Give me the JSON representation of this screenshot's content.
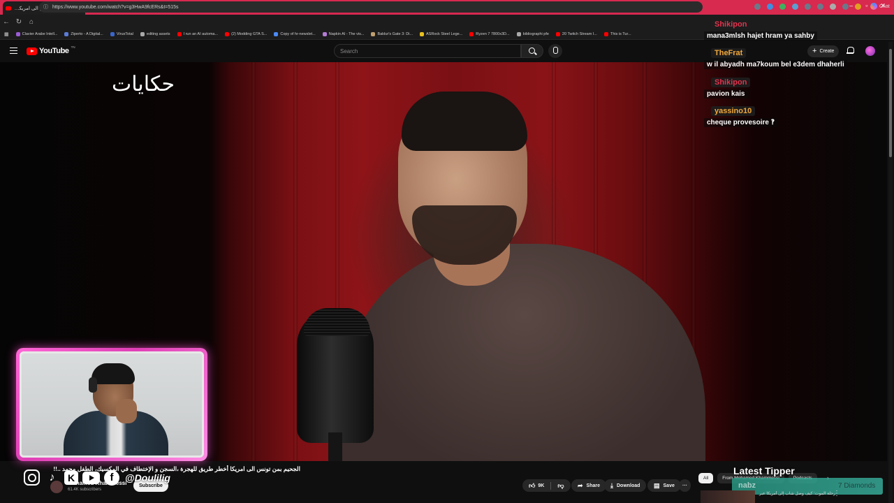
{
  "browser": {
    "tab_title": "الجحيم بمن تونس الى امريكا أخطر...",
    "url": "https://www.youtube.com/watch?v=g3HwA9fcERs&t=515s",
    "window_controls": [
      "–",
      "▫",
      "✕"
    ],
    "new_tab_label": "+",
    "chat_ext_label": "Chat",
    "bookmarks": [
      "Clavier Arabe Intell...",
      "Ziperto - A Digital...",
      "VirusTotal",
      "editing assets",
      "I run an AI automa...",
      "(2) Modding GTA S...",
      "Copy of hr-newslet...",
      "Napkin AI - The vis...",
      "Baldur's Gate 3: Di...",
      "ASRock Steel Lege...",
      "Ryzen 7 7800x3D...",
      "bibliographi pfe",
      "20 Twitch Stream I...",
      "This is Tur..."
    ]
  },
  "youtube": {
    "logo_text": "YouTube",
    "logo_tn": "TN",
    "search_placeholder": "Search",
    "create_label": "Create"
  },
  "video": {
    "overlay_logo": "حكايات",
    "title": "الجحيم بمن تونس الى امريكا أخطر طريق للهجرة ،السجن و الإختطاف في المكسيك، الطفل محمد ..!!",
    "channel_name": "Mohamed Khammessi",
    "subscribers": "61.4K subscribers",
    "subscribe_label": "Subscribe",
    "likes": "9K",
    "share_label": "Share",
    "download_label": "Download",
    "save_label": "Save",
    "more_label": "···"
  },
  "chat": [
    {
      "user": "Shikipon",
      "color": "#e2334d",
      "message": "mana3mlsh hajet hram ya sahby"
    },
    {
      "user": "TheFrat",
      "color": "#f2a93b",
      "message": "w il abyadh ma7koum bel e3dem dhaherli"
    },
    {
      "user": "Shikipon",
      "color": "#e2334d",
      "message": "pavion kais"
    },
    {
      "user": "yassino10",
      "color": "#f2a93b",
      "message": "cheque provesoire ‽"
    }
  ],
  "stream_overlay": {
    "social_handle": "@Doulilig",
    "latest_tipper_label": "Latest Tipper",
    "tipper_name": "nabz",
    "tipper_amount": "7 Diamonds"
  },
  "chips": [
    "All",
    "From Mohamed Khammessi",
    "Podcasts"
  ],
  "recommendation": {
    "title": "رحلة الموت: كيف وصل شاب إلى أمريكا عبر أخطر طريق"
  }
}
